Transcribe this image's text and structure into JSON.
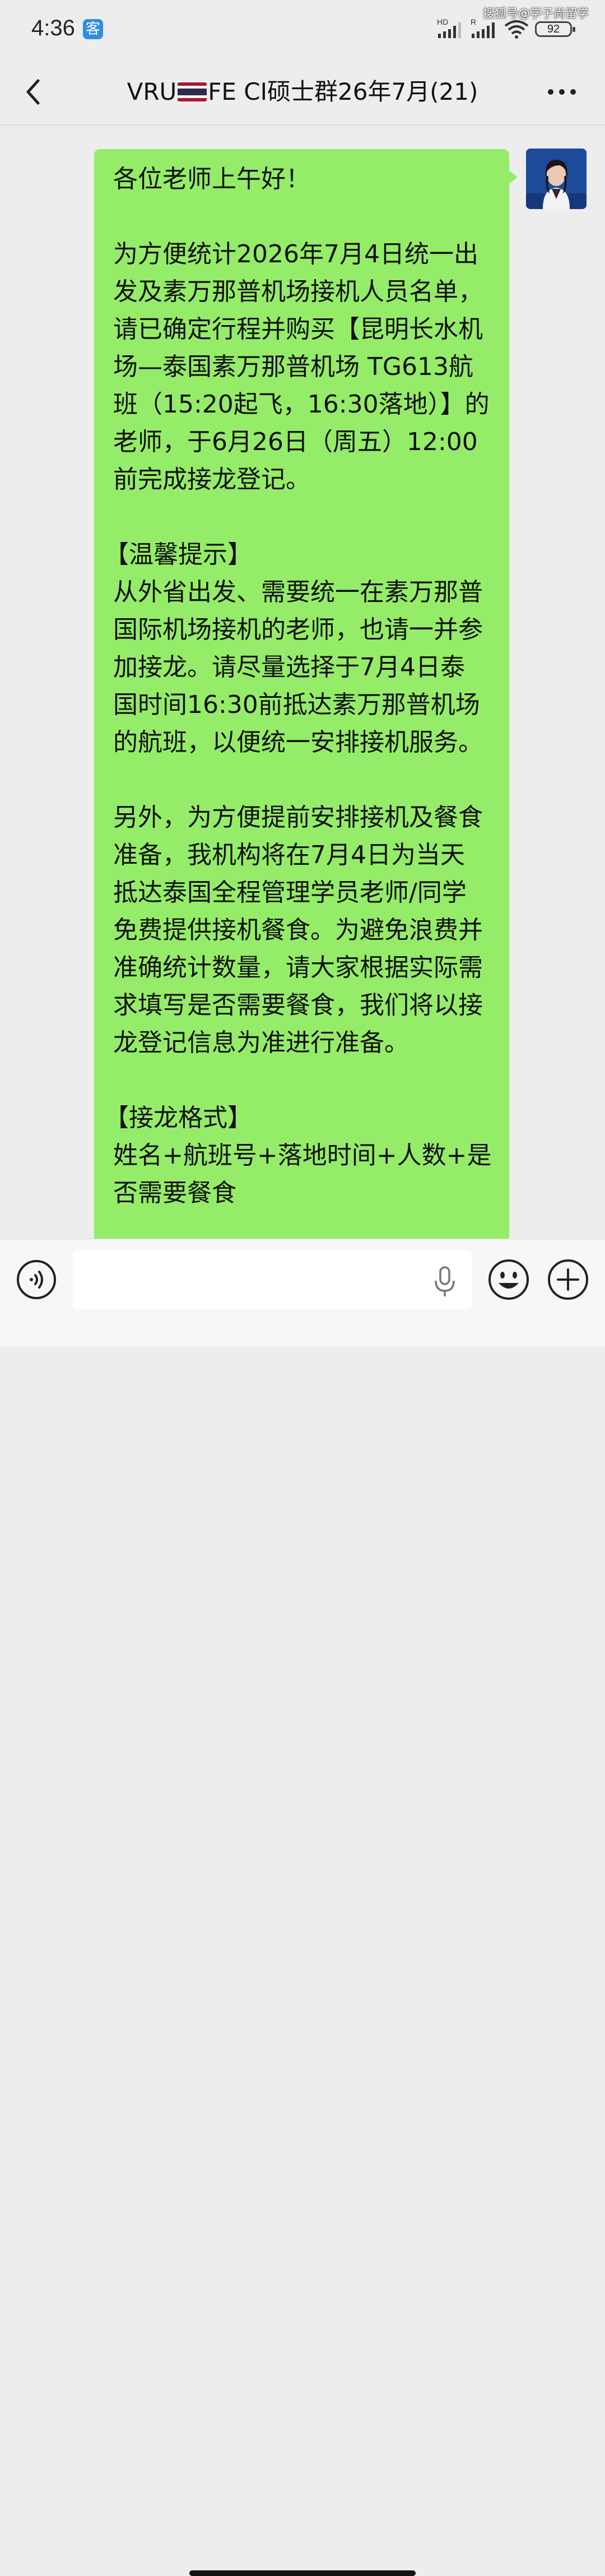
{
  "status_bar": {
    "time": "4:36",
    "app_badge": "客",
    "battery": "92",
    "signal_hd_label": "HD",
    "signal_r_label": "R"
  },
  "watermark": "搜狐号@学子尚留学",
  "header": {
    "title_prefix": "VRU",
    "title_suffix": "FE CI硕士群26年7月(21)"
  },
  "message": {
    "lines": [
      "各位老师上午好！",
      "",
      "为方便统计2026年7月4日统一出",
      "发及素万那普机场接机人员名单，",
      "请已确定行程并购买【昆明长水机",
      "场—泰国素万那普机场 TG613航",
      "班（15:20起飞，16:30落地）】的",
      "老师，于6月26日（周五）12:00",
      "前完成接龙登记。",
      "",
      "【温馨提示】",
      "从外省出发、需要统一在素万那普",
      "国际机场接机的老师，也请一并参",
      "加接龙。请尽量选择于7月4日泰",
      "国时间16:30前抵达素万那普机场",
      "的航班，以便统一安排接机服务。",
      "",
      "另外，为方便提前安排接机及餐食",
      "准备，我机构将在7月4日为当天",
      "抵达泰国全程管理学员老师/同学",
      "免费提供接机餐食。为避免浪费并",
      "准确统计数量，请大家根据实际需",
      "求填写是否需要餐食，我们将以接",
      "龙登记信息为准进行准备。",
      "",
      "【接龙格式】",
      "姓名+航班号+落地时间+人数+是",
      "否需要餐食"
    ]
  },
  "input_bar": {
    "value": "",
    "placeholder": ""
  },
  "colors": {
    "bubble": "#95ec69",
    "background": "#ededed"
  }
}
